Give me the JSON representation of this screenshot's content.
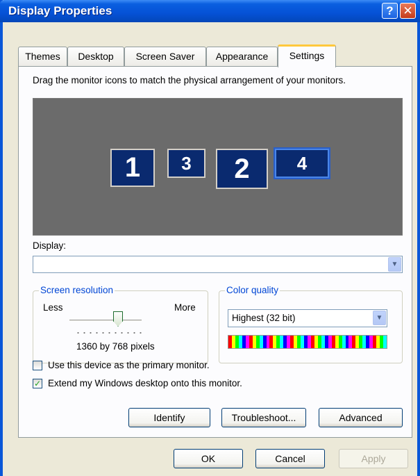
{
  "window": {
    "title": "Display Properties",
    "help_glyph": "?",
    "close_glyph": "✕"
  },
  "tabs": [
    "Themes",
    "Desktop",
    "Screen Saver",
    "Appearance",
    "Settings"
  ],
  "active_tab": "Settings",
  "instruction": "Drag the monitor icons to match the physical arrangement of your monitors.",
  "monitors": [
    "1",
    "3",
    "2",
    "4"
  ],
  "selected_monitor": "4",
  "display": {
    "label": "Display:",
    "value": ""
  },
  "resolution": {
    "title": "Screen resolution",
    "less": "Less",
    "more": "More",
    "value_text": "1360 by 768 pixels"
  },
  "color_quality": {
    "title": "Color quality",
    "value": "Highest (32 bit)"
  },
  "checkboxes": {
    "primary": {
      "label": "Use this device as the primary monitor.",
      "checked": false
    },
    "extend": {
      "label": "Extend my Windows desktop onto this monitor.",
      "checked": true
    }
  },
  "inner_buttons": {
    "identify": "Identify",
    "troubleshoot": "Troubleshoot...",
    "advanced": "Advanced"
  },
  "dialog_buttons": {
    "ok": "OK",
    "cancel": "Cancel",
    "apply": "Apply"
  },
  "colors": {
    "title_bar": "#0551d6",
    "monitor_bg": "#6b6b6b",
    "monitor_tile": "#0a2a6f",
    "group_title": "#0046d5"
  }
}
